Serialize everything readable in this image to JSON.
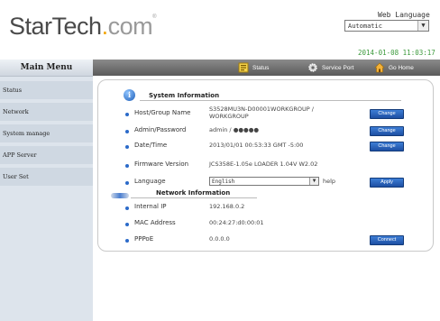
{
  "header": {
    "logo": {
      "part1": "StarTech",
      "dot": ".",
      "part2": "com",
      "reg": "®"
    },
    "language_label": "Web Language",
    "language_value": "Automatic",
    "datetime": "2014-01-08 11:03:17"
  },
  "sidebar": {
    "title": "Main Menu",
    "items": [
      "Status",
      "Network",
      "System manage",
      "APP Server",
      "User Set"
    ]
  },
  "topnav": {
    "status": "Status",
    "service_port": "Service Port",
    "go_home": "Go Home"
  },
  "system_info": {
    "title": "System Information",
    "rows": [
      {
        "label": "Host/Group Name",
        "value_line1": "S3528MU3N-D00001WORKGROUP /",
        "value_line2": "WORKGROUP",
        "button": "Change"
      },
      {
        "label": "Admin/Password",
        "value": "admin / ●●●●●",
        "button": "Change"
      },
      {
        "label": "Date/Time",
        "value": "2013/01/01 00:53:33 GMT -5:00",
        "button": "Change"
      },
      {
        "label": "Firmware Version",
        "value": "JCS358E-1.05e LOADER 1.04V W2.02"
      },
      {
        "label": "Language",
        "select_value": "English",
        "help": "help",
        "button": "Apply"
      }
    ]
  },
  "network_info": {
    "title": "Network Information",
    "rows": [
      {
        "label": "Internal IP",
        "value": "192.168.0.2"
      },
      {
        "label": "MAC Address",
        "value": "00:24:27:d0:00:01"
      },
      {
        "label": "PPPoE",
        "value": "0.0.0.0",
        "button": "Connect"
      }
    ]
  },
  "colors": {
    "accent_blue": "#1d4fa3",
    "datetime_green": "#3c9a3c",
    "logo_orange": "#f2a400"
  }
}
